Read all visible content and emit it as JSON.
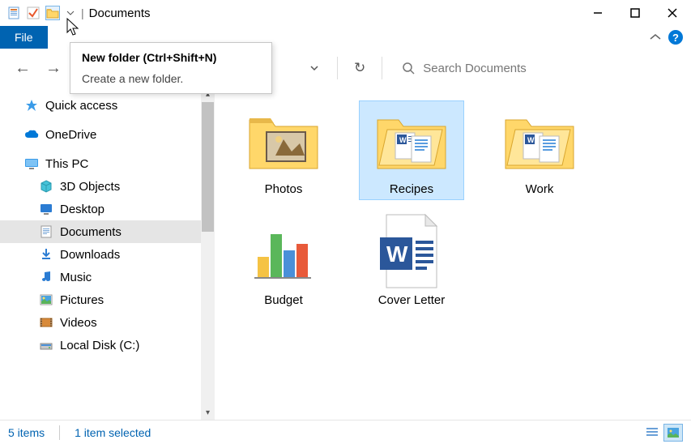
{
  "titlebar": {
    "title": "Documents"
  },
  "ribbon": {
    "file_label": "File"
  },
  "tooltip": {
    "title": "New folder (Ctrl+Shift+N)",
    "desc": "Create a new folder."
  },
  "search": {
    "placeholder": "Search Documents"
  },
  "nav": {
    "quick_access": "Quick access",
    "onedrive": "OneDrive",
    "this_pc": "This PC",
    "objects3d": "3D Objects",
    "desktop": "Desktop",
    "documents": "Documents",
    "downloads": "Downloads",
    "music": "Music",
    "pictures": "Pictures",
    "videos": "Videos",
    "local_disk": "Local Disk (C:)"
  },
  "items": {
    "photos": "Photos",
    "recipes": "Recipes",
    "work": "Work",
    "budget": "Budget",
    "cover_letter": "Cover Letter"
  },
  "status": {
    "count": "5 items",
    "selection": "1 item selected"
  },
  "colors": {
    "accent": "#0063b1"
  }
}
